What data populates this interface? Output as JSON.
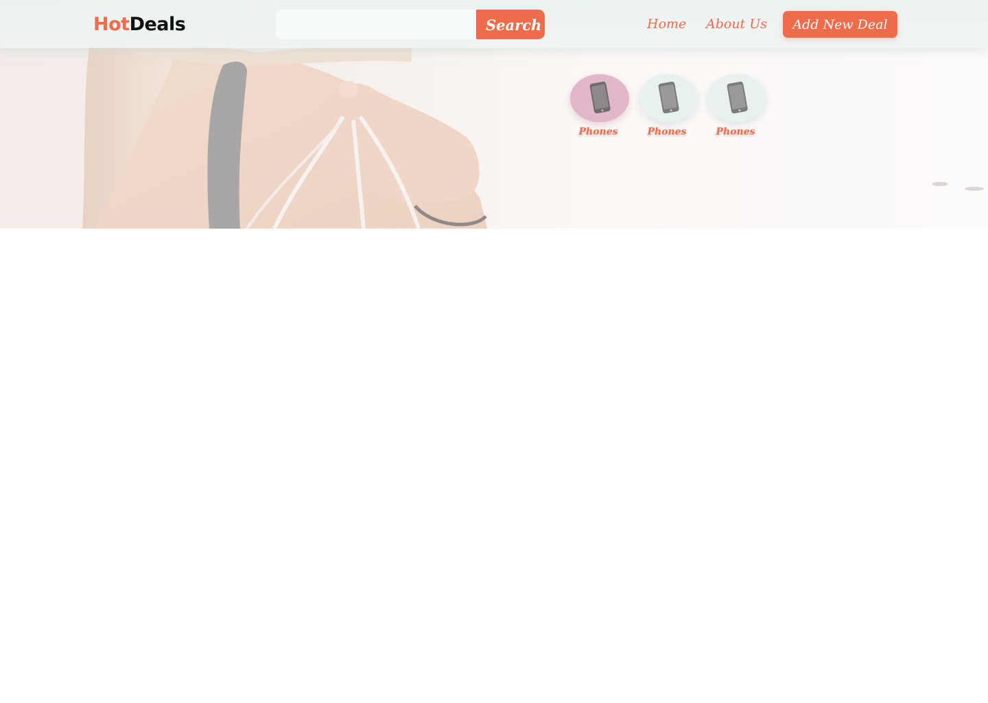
{
  "brand": {
    "part1": "Hot",
    "part2": "Deals",
    "accent_color": "#ef6c4b"
  },
  "search": {
    "value": "",
    "placeholder": "",
    "button_label": "Search"
  },
  "nav": {
    "links": [
      {
        "label": "Home"
      },
      {
        "label": "About Us"
      }
    ],
    "cta_label": "Add New Deal"
  },
  "hero": {
    "image": "woman-holding-shopping-bags-photo"
  },
  "categories": [
    {
      "label": "Phones",
      "icon": "phone-icon",
      "active": true
    },
    {
      "label": "Phones",
      "icon": "phone-icon",
      "active": false
    },
    {
      "label": "Phones",
      "icon": "phone-icon",
      "active": false
    }
  ]
}
